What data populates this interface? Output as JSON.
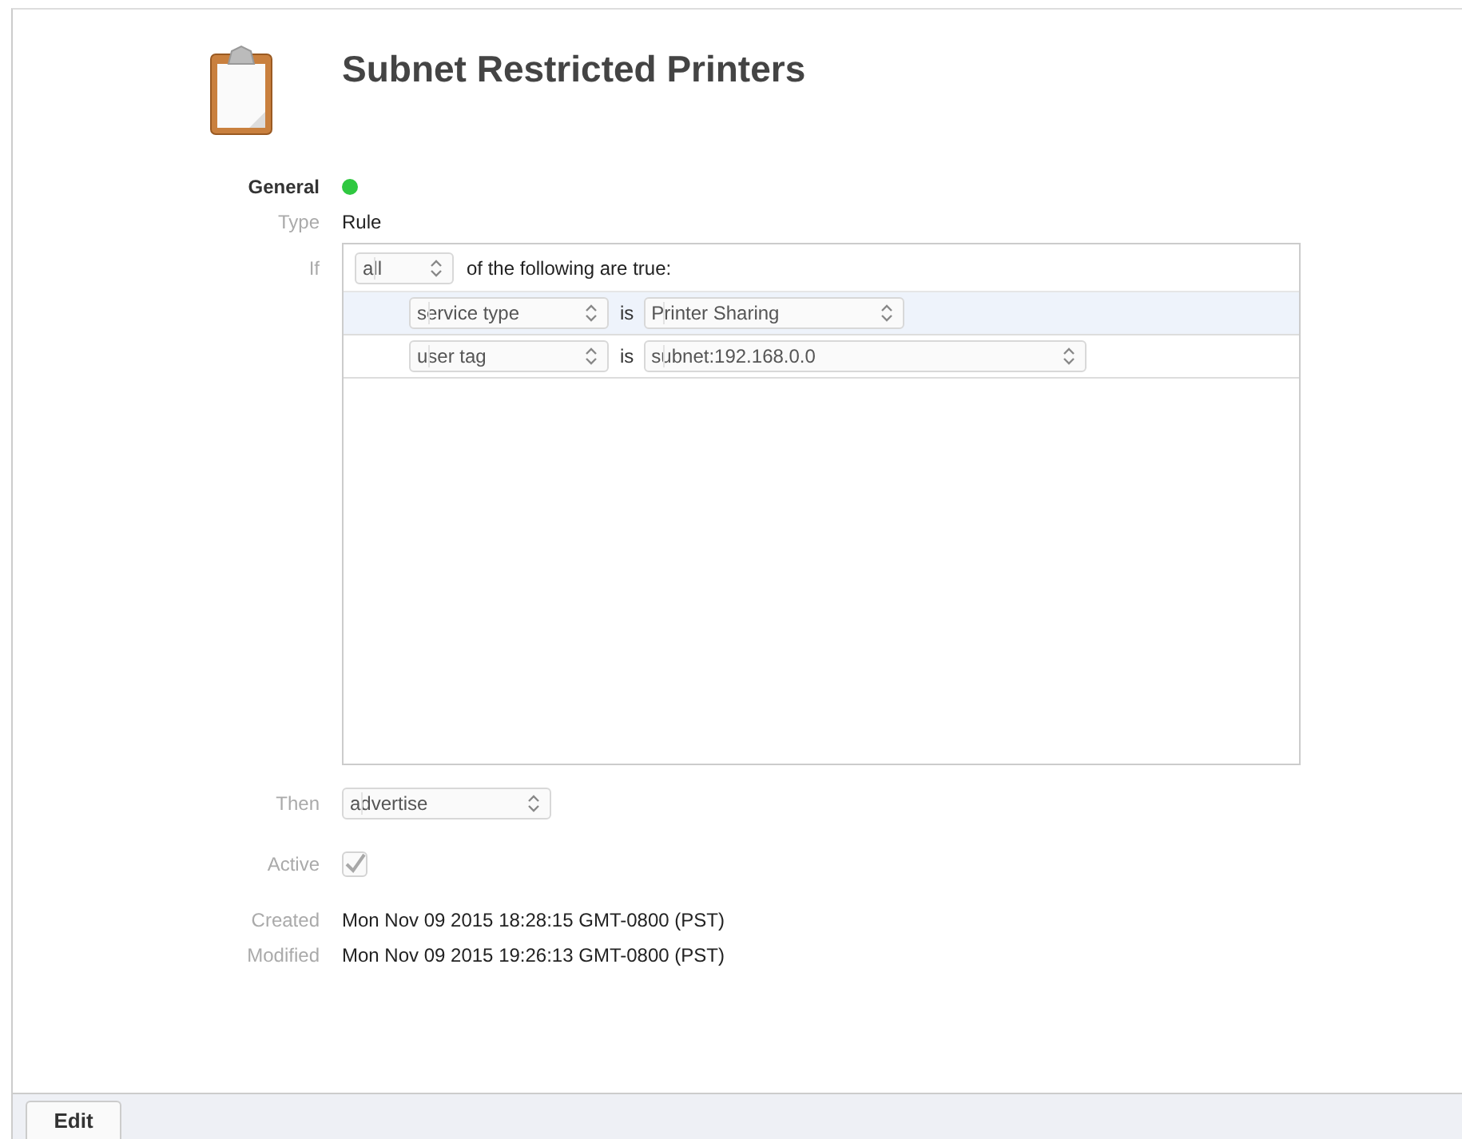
{
  "title": "Subnet Restricted Printers",
  "general": {
    "label": "General",
    "enabled": true
  },
  "type": {
    "label": "Type",
    "value": "Rule"
  },
  "rule": {
    "label": "If",
    "match": "all",
    "match_text": "of the following are true:",
    "conditions": [
      {
        "field": "service type",
        "operator": "is",
        "value": "Printer Sharing",
        "selected": true
      },
      {
        "field": "user tag",
        "operator": "is",
        "value": "subnet:192.168.0.0",
        "selected": false
      }
    ]
  },
  "then": {
    "label": "Then",
    "value": "advertise"
  },
  "active": {
    "label": "Active",
    "checked": true,
    "disabled": true
  },
  "created": {
    "label": "Created",
    "value": "Mon Nov 09 2015 18:28:15 GMT-0800 (PST)"
  },
  "modified": {
    "label": "Modified",
    "value": "Mon Nov 09 2015 19:26:13 GMT-0800 (PST)"
  },
  "footer": {
    "buttons": [
      "Edit"
    ]
  }
}
